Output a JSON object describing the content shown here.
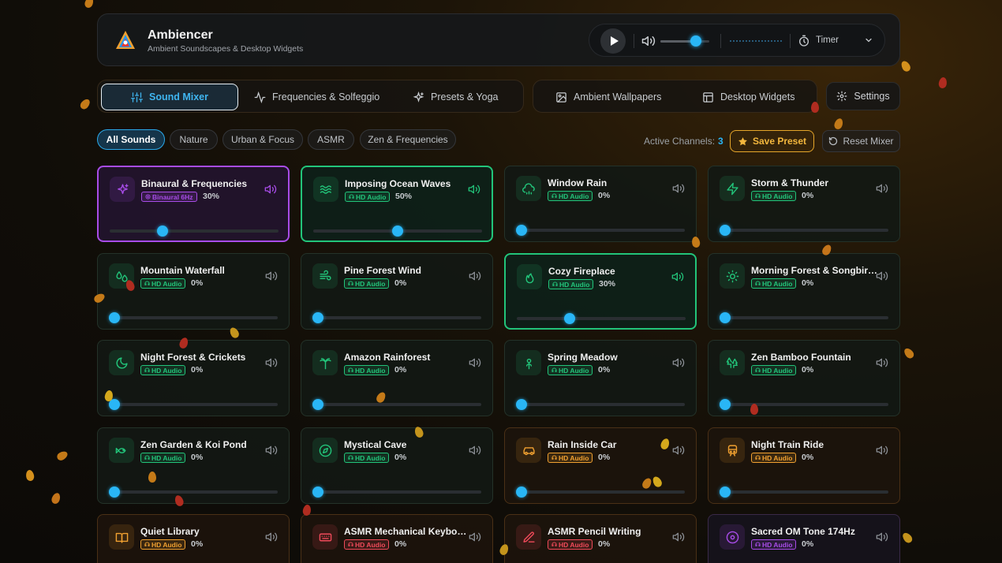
{
  "app": {
    "title": "Ambiencer",
    "subtitle": "Ambient Soundscapes & Desktop Widgets"
  },
  "player": {
    "master_volume": 0.72,
    "timer_label": "Timer"
  },
  "nav": {
    "tabs": [
      {
        "label": "Sound Mixer",
        "icon": "sliders-icon",
        "active": true
      },
      {
        "label": "Frequencies & Solfeggio",
        "icon": "activity-icon",
        "active": false
      },
      {
        "label": "Presets & Yoga",
        "icon": "sparkles-icon",
        "active": false
      },
      {
        "label": "Ambient Wallpapers",
        "icon": "image-icon",
        "active": false
      },
      {
        "label": "Desktop Widgets",
        "icon": "layout-icon",
        "active": false
      }
    ],
    "settings_label": "Settings"
  },
  "filters": {
    "items": [
      "All Sounds",
      "Nature",
      "Urban & Focus",
      "ASMR",
      "Zen & Frequencies"
    ],
    "active": "All Sounds"
  },
  "mixer": {
    "active_channels_label": "Active Channels:",
    "active_channels_count": "3",
    "save_label": "Save Preset",
    "reset_label": "Reset Mixer"
  },
  "colors": {
    "accent": "#29b6f6",
    "nature": "#22c47a",
    "urban": "#f0a030",
    "asmr": "#f04a5a",
    "frequency": "#a84ce8"
  },
  "sounds": [
    {
      "name": "Binaural & Frequencies",
      "badge": "Binaural 6Hz",
      "badge_icon": "target-icon",
      "volume": "30%",
      "level": 0.3,
      "category": "frequency",
      "icon": "sparkles-icon",
      "active": true
    },
    {
      "name": "Imposing Ocean Waves",
      "badge": "HD Audio",
      "badge_icon": "headphones-icon",
      "volume": "50%",
      "level": 0.5,
      "category": "nature",
      "icon": "waves-icon",
      "active": true
    },
    {
      "name": "Window Rain",
      "badge": "HD Audio",
      "badge_icon": "headphones-icon",
      "volume": "0%",
      "level": 0,
      "category": "nature",
      "icon": "cloud-rain-icon",
      "active": false
    },
    {
      "name": "Storm & Thunder",
      "badge": "HD Audio",
      "badge_icon": "headphones-icon",
      "volume": "0%",
      "level": 0,
      "category": "nature",
      "icon": "zap-icon",
      "active": false
    },
    {
      "name": "Mountain Waterfall",
      "badge": "HD Audio",
      "badge_icon": "headphones-icon",
      "volume": "0%",
      "level": 0,
      "category": "nature",
      "icon": "droplets-icon",
      "active": false
    },
    {
      "name": "Pine Forest Wind",
      "badge": "HD Audio",
      "badge_icon": "headphones-icon",
      "volume": "0%",
      "level": 0,
      "category": "nature",
      "icon": "wind-icon",
      "active": false
    },
    {
      "name": "Cozy Fireplace",
      "badge": "HD Audio",
      "badge_icon": "headphones-icon",
      "volume": "30%",
      "level": 0.3,
      "category": "nature",
      "icon": "flame-icon",
      "active": true
    },
    {
      "name": "Morning Forest & Songbirds",
      "badge": "HD Audio",
      "badge_icon": "headphones-icon",
      "volume": "0%",
      "level": 0,
      "category": "nature",
      "icon": "sun-icon",
      "active": false
    },
    {
      "name": "Night Forest & Crickets",
      "badge": "HD Audio",
      "badge_icon": "headphones-icon",
      "volume": "0%",
      "level": 0,
      "category": "nature",
      "icon": "moon-icon",
      "active": false
    },
    {
      "name": "Amazon Rainforest",
      "badge": "HD Audio",
      "badge_icon": "headphones-icon",
      "volume": "0%",
      "level": 0,
      "category": "nature",
      "icon": "palm-icon",
      "active": false
    },
    {
      "name": "Spring Meadow",
      "badge": "HD Audio",
      "badge_icon": "headphones-icon",
      "volume": "0%",
      "level": 0,
      "category": "nature",
      "icon": "flower-icon",
      "active": false
    },
    {
      "name": "Zen Bamboo Fountain",
      "badge": "HD Audio",
      "badge_icon": "headphones-icon",
      "volume": "0%",
      "level": 0,
      "category": "nature",
      "icon": "trees-icon",
      "active": false
    },
    {
      "name": "Zen Garden & Koi Pond",
      "badge": "HD Audio",
      "badge_icon": "headphones-icon",
      "volume": "0%",
      "level": 0,
      "category": "nature",
      "icon": "fish-icon",
      "active": false
    },
    {
      "name": "Mystical Cave",
      "badge": "HD Audio",
      "badge_icon": "headphones-icon",
      "volume": "0%",
      "level": 0,
      "category": "nature",
      "icon": "compass-icon",
      "active": false
    },
    {
      "name": "Rain Inside Car",
      "badge": "HD Audio",
      "badge_icon": "headphones-icon",
      "volume": "0%",
      "level": 0,
      "category": "urban",
      "icon": "car-icon",
      "active": false
    },
    {
      "name": "Night Train Ride",
      "badge": "HD Audio",
      "badge_icon": "headphones-icon",
      "volume": "0%",
      "level": 0,
      "category": "urban",
      "icon": "train-icon",
      "active": false
    },
    {
      "name": "Quiet Library",
      "badge": "HD Audio",
      "badge_icon": "headphones-icon",
      "volume": "0%",
      "level": 0,
      "category": "urban",
      "icon": "book-icon",
      "active": false
    },
    {
      "name": "ASMR Mechanical Keyboard",
      "badge": "HD Audio",
      "badge_icon": "headphones-icon",
      "volume": "0%",
      "level": 0,
      "category": "asmr",
      "icon": "keyboard-icon",
      "active": false
    },
    {
      "name": "ASMR Pencil Writing",
      "badge": "HD Audio",
      "badge_icon": "headphones-icon",
      "volume": "0%",
      "level": 0,
      "category": "asmr",
      "icon": "pen-icon",
      "active": false
    },
    {
      "name": "Sacred OM Tone 174Hz",
      "badge": "HD Audio",
      "badge_icon": "headphones-icon",
      "volume": "0%",
      "level": 0,
      "category": "frequency",
      "icon": "disc-icon",
      "active": false
    }
  ]
}
